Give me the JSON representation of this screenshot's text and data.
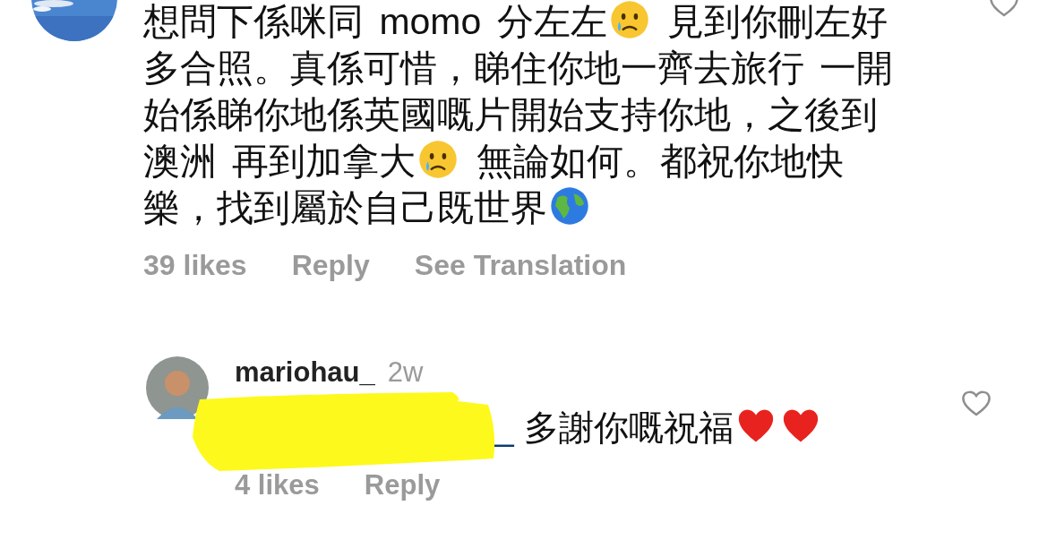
{
  "comments": [
    {
      "avatar": {
        "kind": "picture"
      },
      "text": [
        {
          "kind": "text",
          "text": "想問下係咪同 momo 分左左"
        },
        {
          "kind": "crying"
        },
        {
          "kind": "text",
          "text": " 見到你刪左好多合照。真係可惜，睇住你地一齊去旅行 一開始係睇你地係英國嘅片開始支持你地，之後到澳洲 再到加拿大"
        },
        {
          "kind": "crying"
        },
        {
          "kind": "text",
          "text": " 無論如何。都祝你地快樂，找到屬於自己既世界"
        },
        {
          "kind": "globe"
        }
      ],
      "likes": "39 likes",
      "actions": [
        "Reply",
        "See Translation"
      ],
      "liked": false
    },
    {
      "username": "mariohau_",
      "time": "2w",
      "mention": "_",
      "text": [
        {
          "kind": "text",
          "text": " 多謝你嘅祝福"
        },
        {
          "kind": "heart"
        },
        {
          "kind": "heart"
        }
      ],
      "likes": "4 likes",
      "actions": [
        "Reply"
      ],
      "liked": false
    }
  ]
}
